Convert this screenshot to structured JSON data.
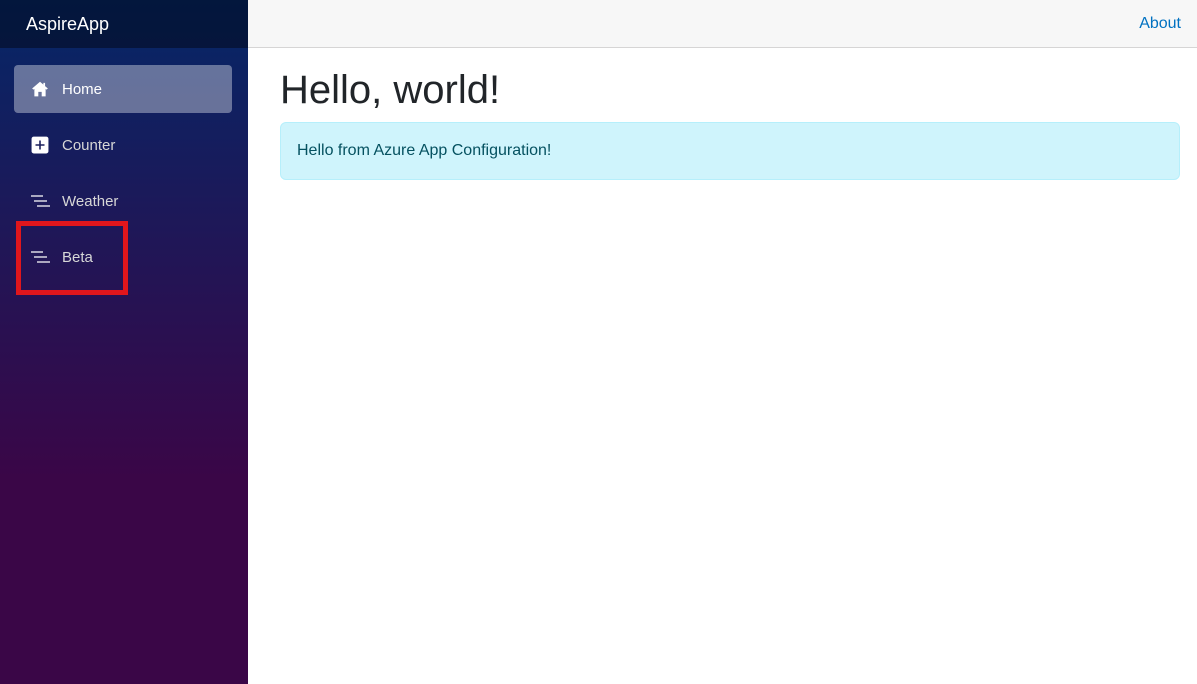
{
  "app": {
    "brand": "AspireApp"
  },
  "sidebar": {
    "items": [
      {
        "label": "Home",
        "icon": "house-icon",
        "active": true
      },
      {
        "label": "Counter",
        "icon": "plus-square-icon",
        "active": false
      },
      {
        "label": "Weather",
        "icon": "list-nested-icon",
        "active": false
      },
      {
        "label": "Beta",
        "icon": "list-nested-icon",
        "active": false
      }
    ]
  },
  "top_row": {
    "about_link": "About"
  },
  "main": {
    "title": "Hello, world!",
    "alert_message": "Hello from Azure App Configuration!"
  },
  "colors": {
    "sidebar_top": "#052767",
    "sidebar_bottom": "#3a0647",
    "link": "#0071c1",
    "alert_bg": "#cff4fc",
    "highlight": "#e0161c"
  }
}
